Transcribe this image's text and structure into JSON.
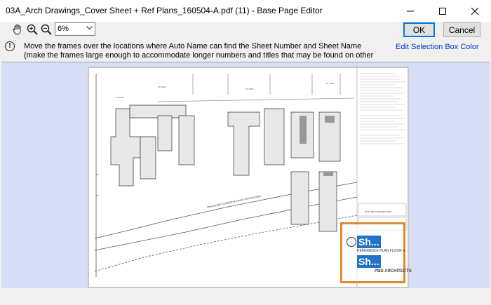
{
  "window": {
    "title": "03A_Arch Drawings_Cover Sheet + Ref Plans_160504-A.pdf (11) - Base Page Editor",
    "minimize_icon": "minimize-icon",
    "maximize_icon": "maximize-icon",
    "close_icon": "close-icon"
  },
  "toolbar": {
    "pan_icon": "hand-pan-icon",
    "zoom_in_icon": "zoom-in-icon",
    "zoom_out_icon": "zoom-out-icon",
    "zoom_value": "6%",
    "ok_label": "OK",
    "cancel_label": "Cancel"
  },
  "info": {
    "line1": "Move the frames over the locations where Auto Name can find the Sheet Number and Sheet Name",
    "line2": "(make the frames large enough to accommodate longer numbers and titles that may be found on other",
    "edit_link": "Edit Selection Box Color"
  },
  "drawing": {
    "title_block_badge_1": "Sh...",
    "title_block_badge_2": "Sh...",
    "title_block_caption": "REFERENCE PLAN FLOOR 4",
    "firm_logo_text": "PBD ARCHITECTS",
    "street_label": "TRANSPORT CORRIDOR INVESTIGATION AREA",
    "not_for_construction": "NOT FOR CONSTRUCTION"
  },
  "colors": {
    "canvas_bg": "#d5def5",
    "selection_box": "#e08a2c",
    "badge_blue": "#1f73c8",
    "link_blue": "#0033cc"
  }
}
